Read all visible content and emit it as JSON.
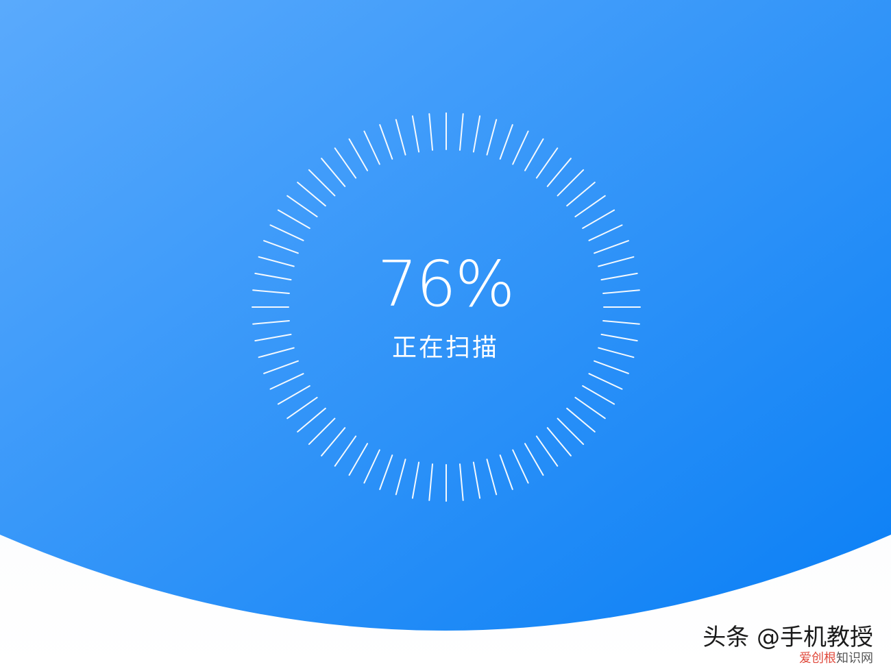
{
  "scan": {
    "percent_text": "76%",
    "progress": 0.76,
    "status_label": "正在扫描"
  },
  "dial": {
    "tick_count": 72,
    "tick_color": "#ffffff"
  },
  "colors": {
    "gradient_light": "#5aaafc",
    "gradient_dark": "#0a7ff5",
    "background_bottom": "#f4f6fb"
  },
  "watermark": {
    "text": "头条 @手机教授",
    "sub_a": "爱创根",
    "sub_b": "知识网"
  }
}
